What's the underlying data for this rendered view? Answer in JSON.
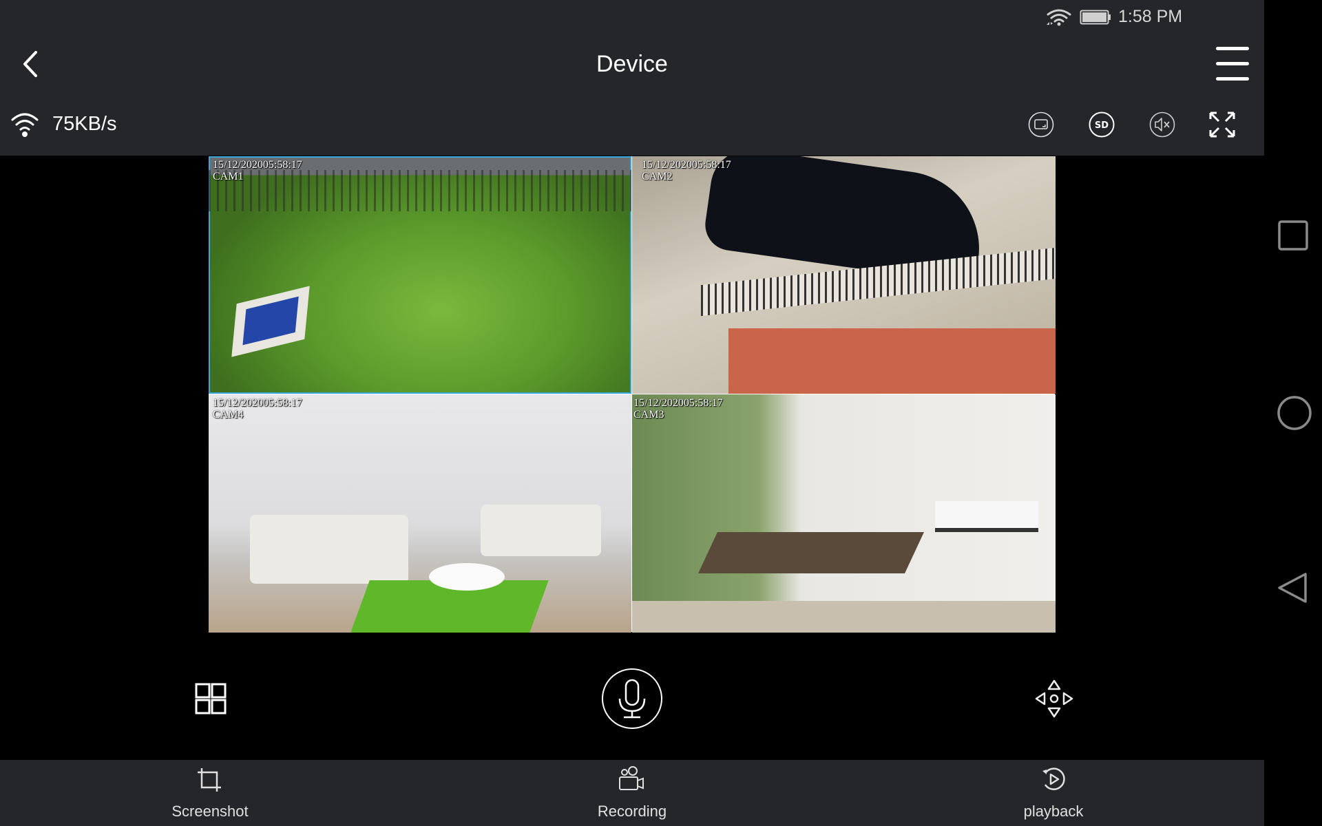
{
  "status_bar": {
    "time": "1:58 PM",
    "icons": [
      "wifi-icon",
      "battery-icon"
    ]
  },
  "header": {
    "title": "Device",
    "back_icon": "chevron-left-icon",
    "menu_icon": "hamburger-menu-icon"
  },
  "stream": {
    "network_speed": "75KB/s",
    "toolbar": [
      {
        "name": "aspect-ratio",
        "icon": "aspect-ratio-icon"
      },
      {
        "name": "quality",
        "icon": "sd-icon",
        "label": "SD"
      },
      {
        "name": "mute",
        "icon": "speaker-muted-icon"
      },
      {
        "name": "fullscreen",
        "icon": "expand-icon"
      }
    ]
  },
  "cameras": [
    {
      "timestamp": "15/12/202005:58:17",
      "label": "CAM1",
      "selected": true
    },
    {
      "timestamp": "15/12/202005:58:17",
      "label": "CAM2",
      "selected": false
    },
    {
      "timestamp": "15/12/202005:58:17",
      "label": "CAM4",
      "selected": false
    },
    {
      "timestamp": "15/12/202005:58:17",
      "label": "CAM3",
      "selected": false
    }
  ],
  "controls": {
    "layout_icon": "grid-layout-icon",
    "talk_icon": "microphone-icon",
    "ptz_icon": "ptz-direction-icon"
  },
  "bottom_nav": [
    {
      "label": "Screenshot",
      "icon": "crop-icon"
    },
    {
      "label": "Recording",
      "icon": "video-camera-icon"
    },
    {
      "label": "playback",
      "icon": "replay-icon"
    }
  ],
  "system_nav": [
    "recents-icon",
    "home-icon",
    "back-icon"
  ],
  "colors": {
    "header_bg": "#25262a",
    "selection": "#3aa7dc"
  }
}
